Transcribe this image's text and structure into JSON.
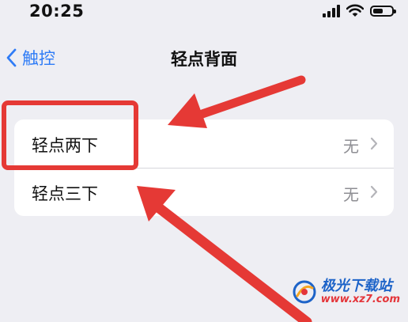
{
  "status_bar": {
    "time": "20:25"
  },
  "nav": {
    "back_label": "触控",
    "title": "轻点背面"
  },
  "rows": [
    {
      "label": "轻点两下",
      "value": "无"
    },
    {
      "label": "轻点三下",
      "value": "无"
    }
  ],
  "colors": {
    "accent": "#2f7cf6",
    "annotation": "#e53935",
    "background": "#eeeef3"
  },
  "icons": [
    "signal-icon",
    "wifi-icon",
    "battery-icon",
    "chevron-left-icon",
    "chevron-right-icon"
  ],
  "watermark": {
    "brand": "极光下载站",
    "url": "www.xz7.com"
  }
}
